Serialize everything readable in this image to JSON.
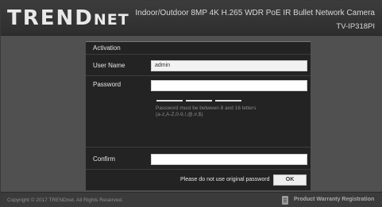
{
  "header": {
    "logo_main": "TREND",
    "logo_small": "NET",
    "product_title": "Indoor/Outdoor 8MP 4K H.265 WDR PoE IR Bullet Network Camera",
    "model": "TV-IP318PI"
  },
  "form": {
    "section_title": "Activation",
    "username_label": "User Name",
    "username_value": "admin",
    "password_label": "Password",
    "password_value": "",
    "password_hint_line1": "Password must be between 8 and 16 letters",
    "password_hint_line2": "(a-z,A-Z,0-9,!,@,#,$)",
    "confirm_label": "Confirm",
    "confirm_value": "",
    "notice": "Please do not use original password",
    "ok_label": "OK"
  },
  "footer": {
    "copyright": "Copyright © 2017 TRENDnet. All Rights Reserved.",
    "warranty_link": "Product Warranty Registration",
    "warranty_icon": "document-icon"
  },
  "colors": {
    "background": "#505050",
    "panel": "#232323",
    "header": "#333333"
  }
}
